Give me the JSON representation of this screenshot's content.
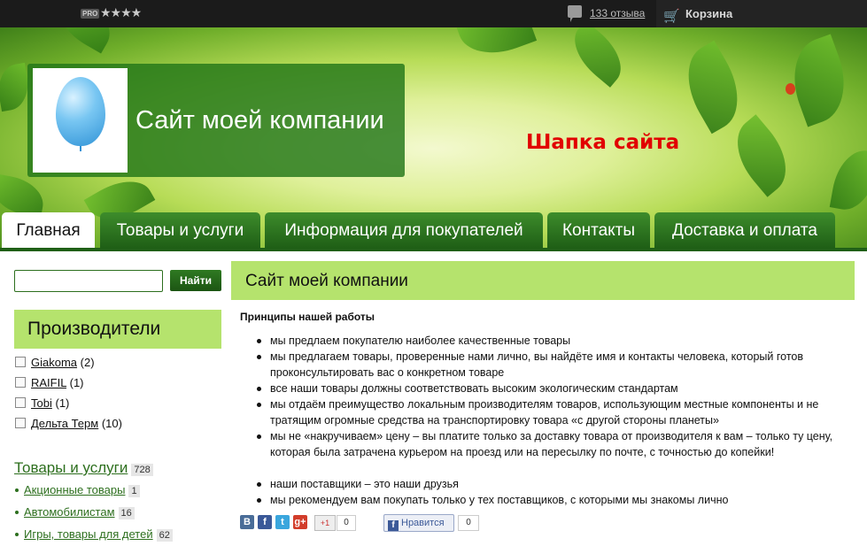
{
  "topbar": {
    "pro_badge": "PRO",
    "stars": "★★★★",
    "reviews_link": "133 отзыва",
    "cart_label": "Корзина"
  },
  "header": {
    "company_name": "Сайт моей компании",
    "caption": "Шапка сайта"
  },
  "nav": {
    "tabs": [
      {
        "label": "Главная",
        "active": true
      },
      {
        "label": "Товары и услуги"
      },
      {
        "label": "Информация для покупателей"
      },
      {
        "label": "Контакты"
      },
      {
        "label": "Доставка и оплата"
      }
    ]
  },
  "search": {
    "value": "",
    "button_label": "Найти"
  },
  "sidebar": {
    "manufacturers_title": "Производители",
    "manufacturers": [
      {
        "name": "Giakoma",
        "count": "(2)"
      },
      {
        "name": "RAIFIL",
        "count": "(1)"
      },
      {
        "name": "Tobi",
        "count": "(1)"
      },
      {
        "name": "Дельта Терм",
        "count": "(10)"
      }
    ],
    "categories_title": "Товары и услуги",
    "categories_count": "728",
    "categories": [
      {
        "name": "Акционные товары",
        "count": "1"
      },
      {
        "name": "Автомобилистам",
        "count": "16"
      },
      {
        "name": "Игры, товары для детей",
        "count": "62"
      }
    ]
  },
  "main": {
    "title": "Сайт моей компании",
    "subheading": "Принципы нашей работы",
    "bullets": [
      "мы предлаем покупателю наиболее качественные товары",
      "мы предлагаем товары, проверенные нами лично, вы найдёте имя и контакты человека, который готов проконсультировать вас о конкретном товаре",
      "все наши товары должны соответствовать высоким экологическим стандартам",
      "мы отдаём преимущество локальным производителям товаров, использующим местные компоненты и не тратящим огромные средства на транспортировку товара «с другой стороны планеты»",
      "мы не «накручиваем» цену – вы платите только за доставку товара от производителя к вам – только ту цену, которая была затрачена курьером на проезд или на пересылку по почте, с точностью до копейки!",
      "наши поставщики – это наши друзья",
      "мы рекомендуем вам покупать только у тех поставщиков, с которыми мы знакомы лично"
    ]
  },
  "share": {
    "gplus_label": "+1",
    "gplus_count": "0",
    "like_label": "Нравится",
    "like_count": "0"
  }
}
